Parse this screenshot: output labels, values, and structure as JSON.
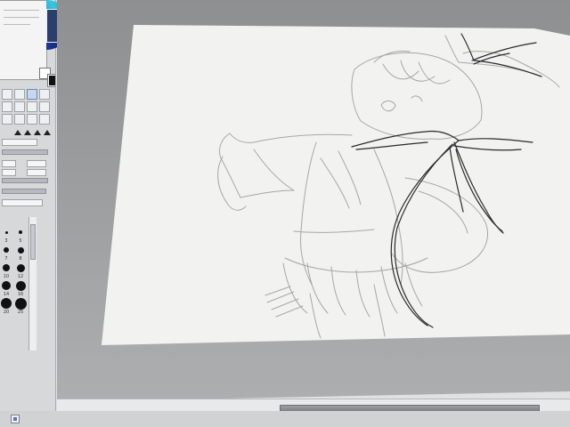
{
  "app": {
    "name": ""
  },
  "left_panel": {
    "color_label": "",
    "tool_rows": [
      [
        "",
        "",
        "",
        ""
      ],
      [
        "",
        "",
        "",
        ""
      ],
      [
        "",
        "",
        "",
        ""
      ]
    ],
    "blend_label": "",
    "density_value": "",
    "size_value": "",
    "option_label": "",
    "brush_sizes": [
      "3",
      "5",
      "7",
      "8",
      "10",
      "12",
      "14",
      "16",
      "20",
      "25"
    ]
  },
  "canvas": {
    "background": "#f2f2f0",
    "sketch_color": "#9a9a9e",
    "ink_color": "#2a2a2e"
  },
  "scrollbars": {
    "horizontal_position": 0.55
  }
}
